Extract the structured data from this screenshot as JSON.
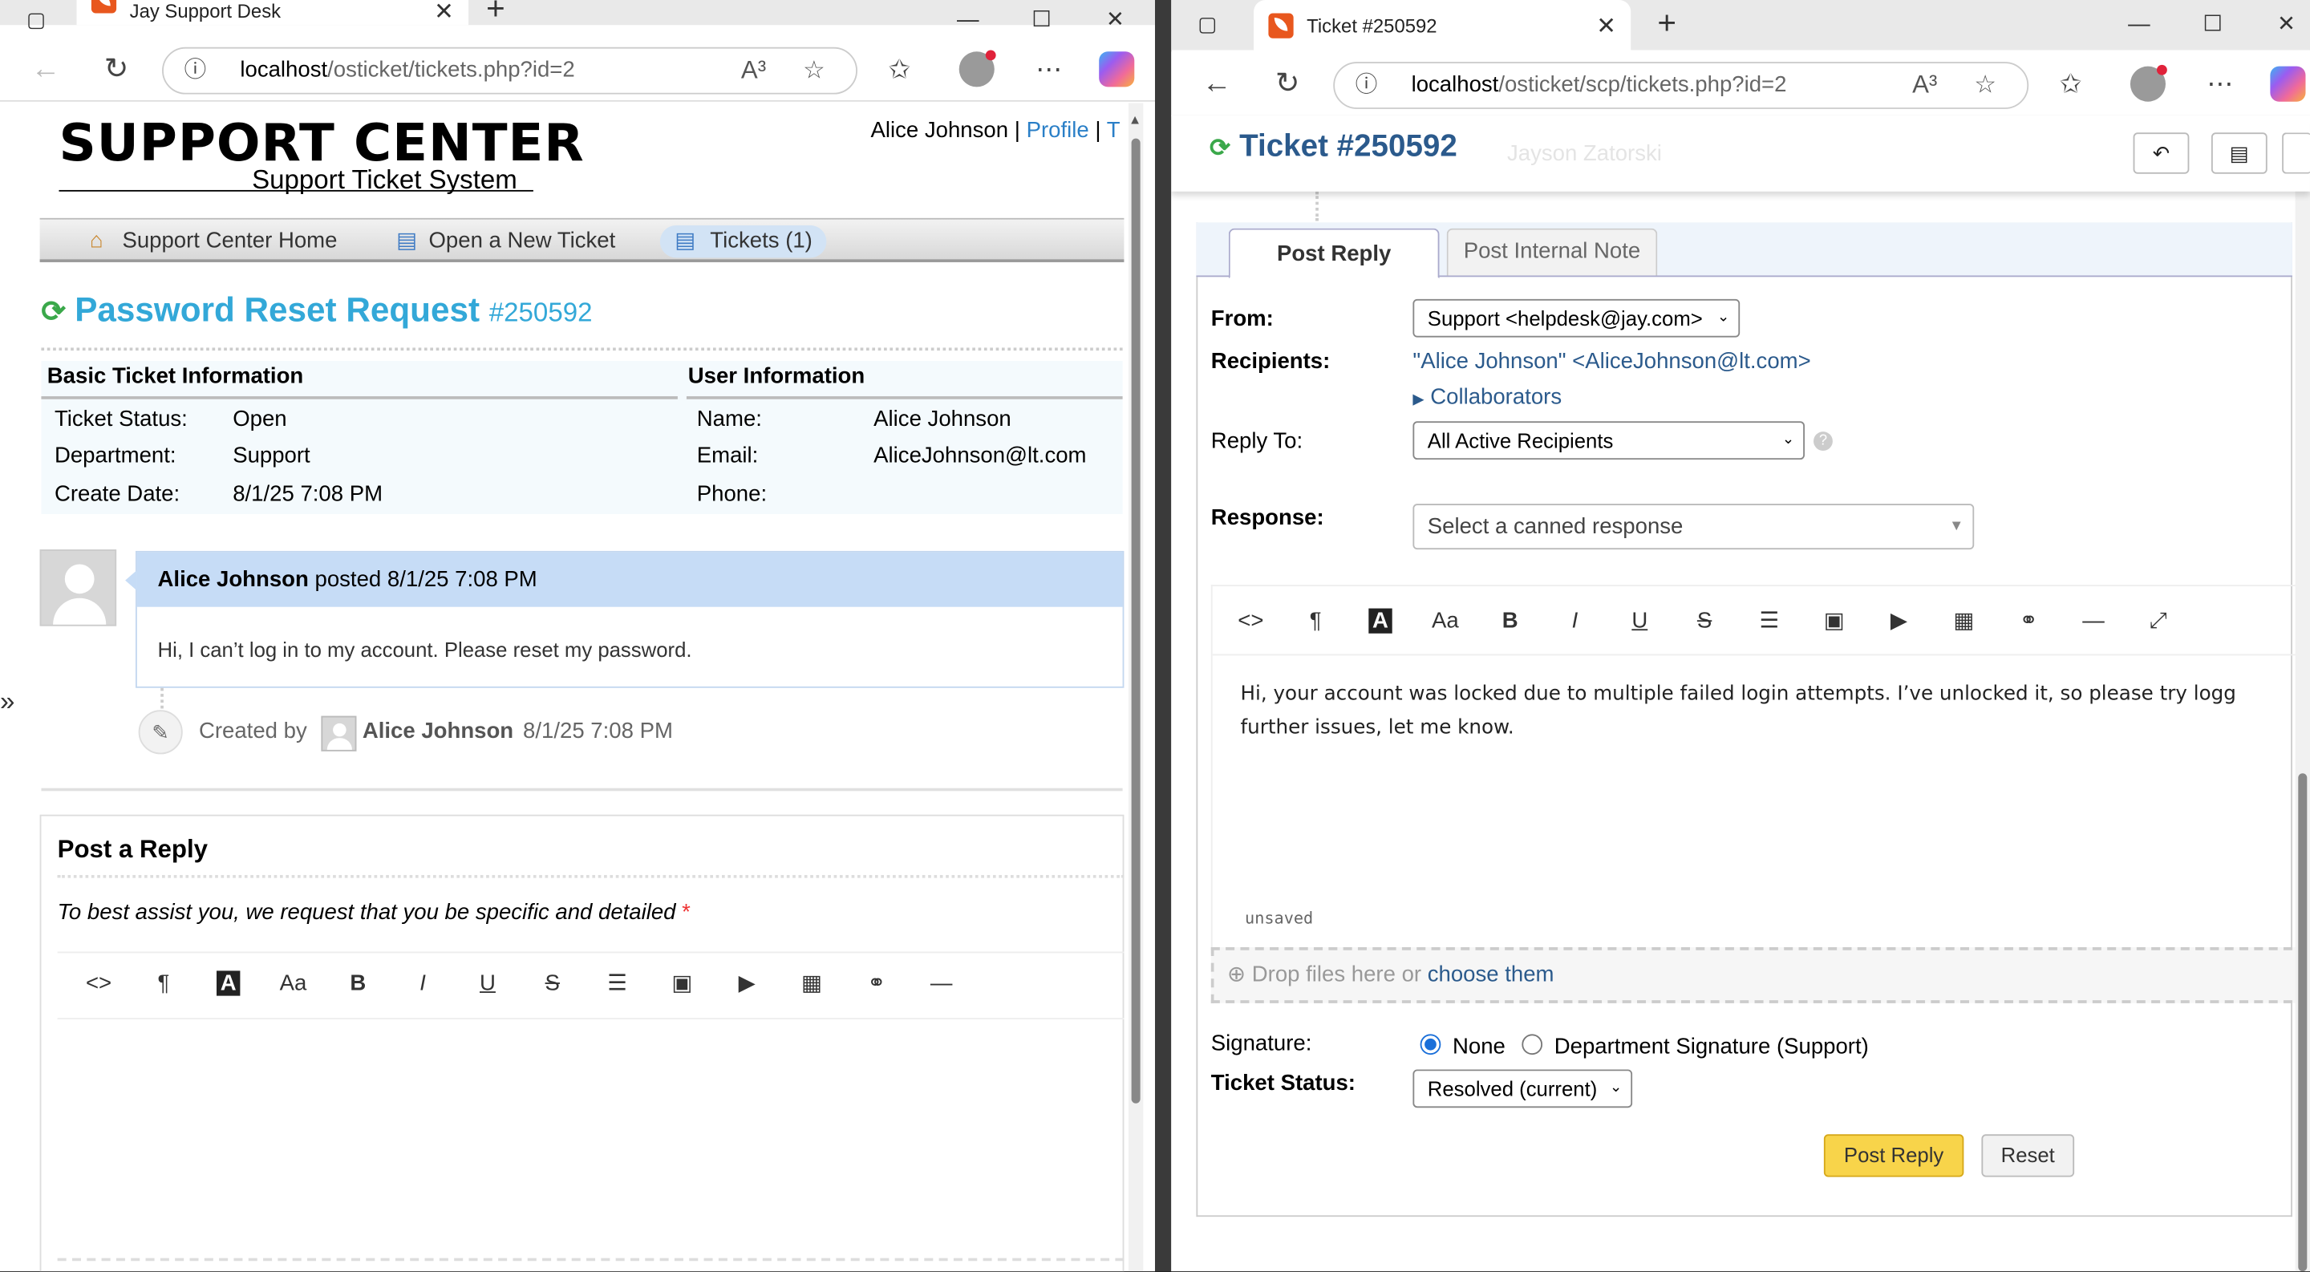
{
  "left_browser": {
    "tab_title": "Jay Support Desk",
    "url": "localhost/osticket/tickets.php?id=2",
    "url_host": "localhost",
    "url_path": "/osticket/tickets.php?id=2",
    "info_icon": "ⓘ",
    "read_icon": "A³",
    "star_icon": "☆",
    "favorites_icon": "✩",
    "menu_icon": "⋯"
  },
  "left_page": {
    "logo_main": "SUPPORT CENTER",
    "logo_sub": "Support Ticket System",
    "user_name": "Alice Johnson",
    "user_sep": "|",
    "profile_link": "Profile",
    "user_sep2": "|",
    "tickets_link_partial": "T",
    "nav": [
      {
        "label": "Support Center Home",
        "icon": "home-icon"
      },
      {
        "label": "Open a New Ticket",
        "icon": "new-ticket-icon"
      },
      {
        "label": "Tickets (1)",
        "icon": "tickets-icon"
      }
    ],
    "ticket_title": "Password Reset Request",
    "ticket_number": "#250592",
    "basic_info_header": "Basic Ticket Information",
    "user_info_header": "User Information",
    "basic_info": [
      {
        "label": "Ticket Status:",
        "value": "Open"
      },
      {
        "label": "Department:",
        "value": "Support"
      },
      {
        "label": "Create Date:",
        "value": "8/1/25 7:08 PM"
      }
    ],
    "user_info": [
      {
        "label": "Name:",
        "value": "Alice Johnson"
      },
      {
        "label": "Email:",
        "value": "AliceJohnson@lt.com"
      },
      {
        "label": "Phone:",
        "value": ""
      }
    ],
    "post": {
      "author": "Alice Johnson",
      "posted_text": "posted 8/1/25 7:08 PM",
      "body": "Hi, I can’t log in to my account. Please reset my password."
    },
    "event": {
      "prefix": "Created by",
      "author": "Alice Johnson",
      "time": "8/1/25 7:08 PM"
    },
    "reply": {
      "title": "Post a Reply",
      "hint": "To best assist you, we request that you be specific and detailed",
      "required": "*"
    },
    "toolbar": [
      "<>",
      "¶",
      "A",
      "Aa",
      "B",
      "I",
      "U",
      "S",
      "☰",
      "▣",
      "▶",
      "▦",
      "⚭",
      "—"
    ]
  },
  "right_browser": {
    "tab_title": "Ticket #250592",
    "url_host": "localhost",
    "url_path": "/osticket/scp/tickets.php?id=2"
  },
  "right_page": {
    "ticket_title": "Ticket #250592",
    "ghost_name": "Jayson Zatorski",
    "tabs": [
      "Post Reply",
      "Post Internal Note"
    ],
    "from_label": "From:",
    "from_value": "Support <helpdesk@jay.com>",
    "recipients_label": "Recipients:",
    "recipients_value": "\"Alice Johnson\" <AliceJohnson@lt.com>",
    "collaborators": "Collaborators",
    "reply_to_label": "Reply To:",
    "reply_to_value": "All Active Recipients",
    "response_label": "Response:",
    "canned_placeholder": "Select a canned response",
    "toolbar": [
      "<>",
      "¶",
      "A",
      "Aa",
      "B",
      "I",
      "U",
      "S",
      "☰",
      "▣",
      "▶",
      "▦",
      "⚭",
      "—",
      "⤢"
    ],
    "editor_line1": "Hi, your account was locked due to multiple failed login attempts. I’ve unlocked it, so please try logg",
    "editor_line2": "further issues, let me know.",
    "unsaved": "unsaved",
    "drop_text": "Drop files here or",
    "drop_link": "choose them",
    "signature_label": "Signature:",
    "sig_none": "None",
    "sig_dept": "Department Signature (Support)",
    "status_label": "Ticket Status:",
    "status_value": "Resolved (current)",
    "post_button": "Post Reply",
    "reset_button": "Reset"
  }
}
